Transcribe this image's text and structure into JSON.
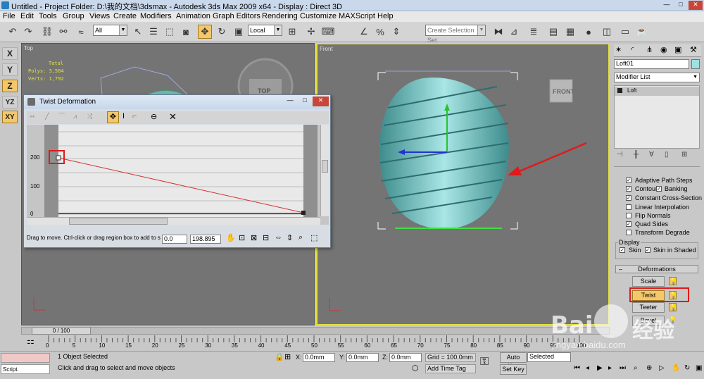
{
  "window": {
    "title": "Untitled     - Project Folder: D:\\我的文档\\3dsmax     - Autodesk 3ds Max  2009 x64      - Display : Direct 3D"
  },
  "menu": [
    "File",
    "Edit",
    "Tools",
    "Group",
    "Views",
    "Create",
    "Modifiers",
    "Animation",
    "Graph Editors",
    "Rendering",
    "Customize",
    "MAXScript",
    "Help"
  ],
  "toolbar": {
    "filter_value": "All",
    "refcoord_value": "Local",
    "selection_set_placeholder": "Create Selection Set"
  },
  "axis_buttons": [
    "X",
    "Y",
    "Z",
    "YZ",
    "XY"
  ],
  "viewports": {
    "top_label": "Top",
    "top_stats_header": "Total",
    "top_polys": "Polys: 3,584",
    "top_verts": "Verts: 1,792",
    "top_cube": "TOP",
    "front_label": "Front",
    "front_cube": "FRONT"
  },
  "dialog": {
    "title": "Twist Deformation",
    "y_labels": [
      "200",
      "100",
      "0"
    ],
    "status_text": "Drag to move. Ctrl-click or drag region box to add to s",
    "x_value": "0.0",
    "y_value": "198.895"
  },
  "command_panel": {
    "object_name": "Loft01",
    "modifier_list": "Modifier List",
    "stack_item": "Loft",
    "checkboxes": [
      {
        "label": "Adaptive Path Steps",
        "checked": true
      },
      {
        "label": "Contour",
        "checked": true
      },
      {
        "label": "Banking",
        "checked": true
      },
      {
        "label": "Constant Cross-Section",
        "checked": true
      },
      {
        "label": "Linear Interpolation",
        "checked": false
      },
      {
        "label": "Flip Normals",
        "checked": false
      },
      {
        "label": "Quad Sides",
        "checked": true
      },
      {
        "label": "Transform Degrade",
        "checked": false
      }
    ],
    "display_header": "Display",
    "display_skin": "Skin",
    "display_skin_shaded": "Skin in Shaded",
    "deformations_header": "Deformations",
    "def_buttons": [
      "Scale",
      "Twist",
      "Teeter",
      "Bevel"
    ]
  },
  "timeline": {
    "frame_label": "0 / 100",
    "ticks": [
      "0",
      "5",
      "10",
      "15",
      "20",
      "25",
      "30",
      "35",
      "40",
      "45",
      "50",
      "55",
      "60",
      "65",
      "70",
      "75",
      "80",
      "85",
      "90",
      "95",
      "100"
    ]
  },
  "status": {
    "script_label": "Script.",
    "selected": "1 Object Selected",
    "prompt": "Click and drag to select and move objects",
    "x_label": "X:",
    "x_value": "0.0mm",
    "y_label": "Y:",
    "y_value": "0.0mm",
    "z_label": "Z:",
    "z_value": "0.0mm",
    "grid": "Grid = 100.0mm",
    "add_time_tag": "Add Time Tag",
    "auto_key": "Auto Key",
    "set_key": "Set Key",
    "selected_dd": "Selected"
  },
  "watermark": {
    "brand": "Bai",
    "sub": "经验",
    "url": "jingyan.baidu.com"
  }
}
